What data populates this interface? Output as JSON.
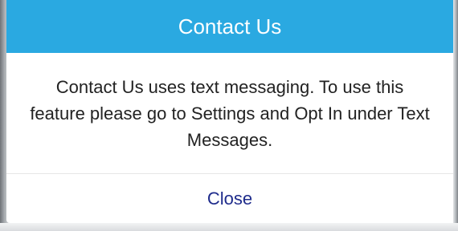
{
  "dialog": {
    "title": "Contact Us",
    "message": "Contact Us uses text messaging. To use this feature please go to Settings and Opt In under Text Messages.",
    "close_label": "Close"
  },
  "colors": {
    "header_background": "#2aa9e1",
    "header_text": "#ffffff",
    "message_text": "#222222",
    "close_text": "#1f2c8c"
  }
}
